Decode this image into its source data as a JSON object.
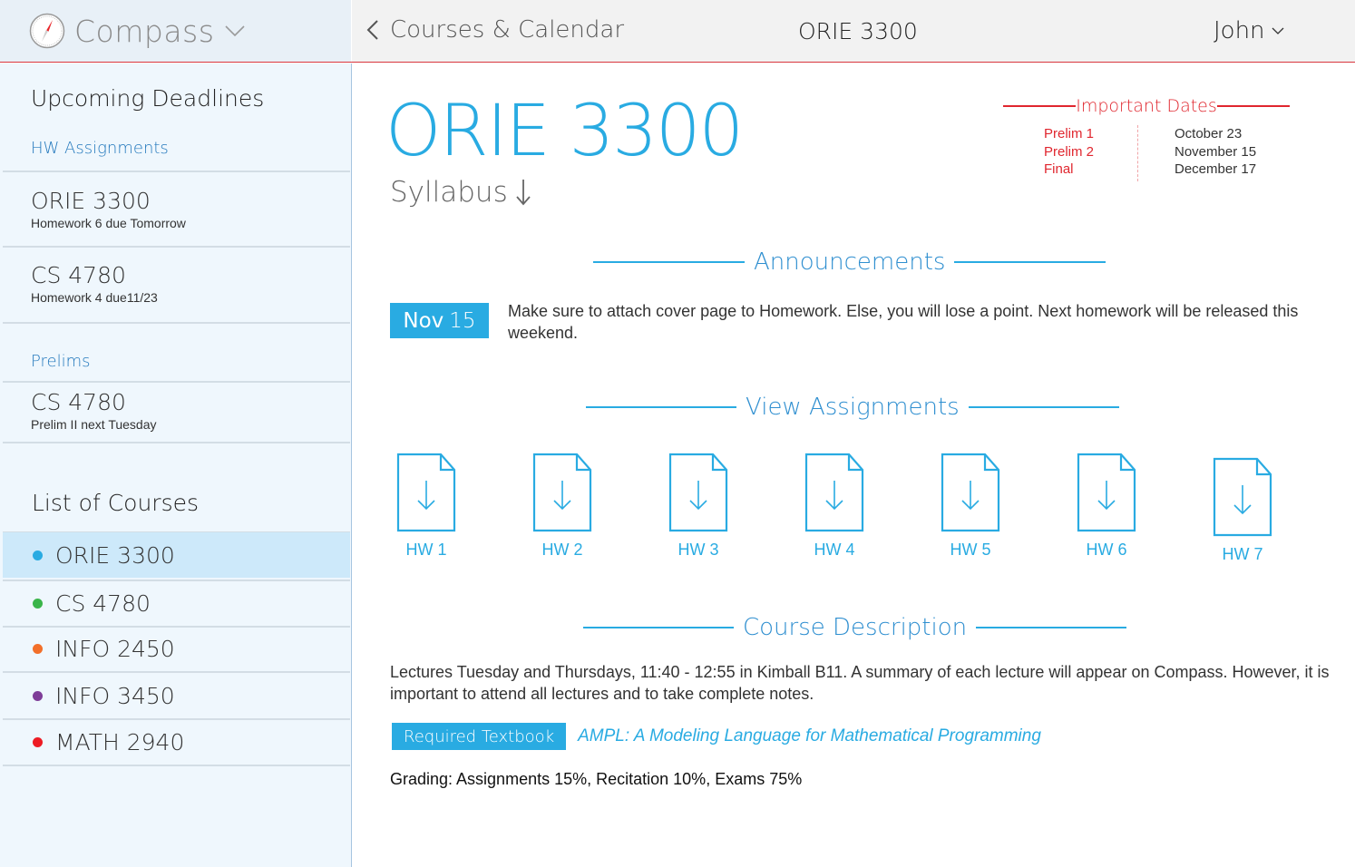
{
  "app": {
    "name": "Compass",
    "logo_icon": "compass-icon"
  },
  "nav": {
    "back_label": "Courses & Calendar",
    "title": "ORIE 3300",
    "user": "John"
  },
  "sidebar": {
    "deadlines_heading": "Upcoming Deadlines",
    "hw_heading": "HW Assignments",
    "hw_items": [
      {
        "course": "ORIE 3300",
        "note": "Homework 6 due Tomorrow"
      },
      {
        "course": "CS 4780",
        "note": "Homework 4 due11/23"
      }
    ],
    "prelims_heading": "Prelims",
    "prelim_items": [
      {
        "course": "CS 4780",
        "note": "Prelim II next Tuesday"
      }
    ],
    "courses_heading": "List of Courses",
    "courses": [
      {
        "label": "ORIE 3300",
        "color": "#29abe2",
        "active": true
      },
      {
        "label": "CS 4780",
        "color": "#3ab54a",
        "active": false
      },
      {
        "label": "INFO 2450",
        "color": "#f26f2a",
        "active": false
      },
      {
        "label": "INFO 3450",
        "color": "#7e3d98",
        "active": false
      },
      {
        "label": "MATH 2940",
        "color": "#ed1c24",
        "active": false
      }
    ]
  },
  "main": {
    "course_title": "ORIE 3300",
    "syllabus_label": "Syllabus",
    "important_dates": {
      "heading": "Important Dates",
      "rows": [
        {
          "event": "Prelim 1",
          "date": "October 23"
        },
        {
          "event": "Prelim 2",
          "date": "November 15"
        },
        {
          "event": "Final",
          "date": "December 17"
        }
      ]
    },
    "announcements": {
      "heading": "Announcements",
      "items": [
        {
          "month": "Nov",
          "day": "15",
          "text": "Make sure to attach cover page to Homework. Else, you will lose a point. Next homework will be released this weekend."
        }
      ]
    },
    "assignments": {
      "heading": "View Assignments",
      "items": [
        "HW 1",
        "HW 2",
        "HW 3",
        "HW 4",
        "HW 5",
        "HW 6",
        "HW 7"
      ]
    },
    "description": {
      "heading": "Course Description",
      "text": "Lectures Tuesday and Thursdays, 11:40 - 12:55 in Kimball B11. A summary of each lecture will appear on Compass. However, it is important to attend all lectures and to take complete notes.",
      "textbook_badge": "Required Textbook",
      "textbook_title": "AMPL: A Modeling Language for Mathematical Programming",
      "grading": "Grading: Assignments 15%, Recitation 10%, Exams 75%"
    }
  },
  "colors": {
    "accent": "#29abe2",
    "alert": "#e0262e",
    "sidebar_bg": "#eff7fd"
  }
}
